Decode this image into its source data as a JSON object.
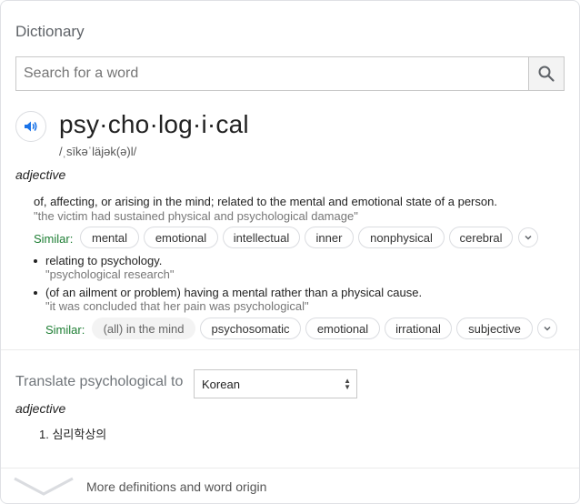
{
  "header": {
    "title": "Dictionary"
  },
  "search": {
    "placeholder": "Search for a word",
    "icon": "search-icon"
  },
  "entry": {
    "headword": "psy·cho·log·i·cal",
    "phonetic": "/ˌsīkəˈläjək(ə)l/",
    "part_of_speech": "adjective",
    "definitions": [
      {
        "text": "of, affecting, or arising in the mind; related to the mental and emotional state of a person.",
        "example": "\"the victim had sustained physical and psychological damage\"",
        "similar_label": "Similar:",
        "similar": [
          "mental",
          "emotional",
          "intellectual",
          "inner",
          "nonphysical",
          "cerebral"
        ]
      }
    ],
    "sub_definitions": [
      {
        "text": "relating to psychology.",
        "example": "\"psychological research\""
      },
      {
        "text": "(of an ailment or problem) having a mental rather than a physical cause.",
        "example": "\"it was concluded that her pain was psychological\""
      }
    ],
    "similar2_label": "Similar:",
    "similar2": [
      "(all) in the mind",
      "psychosomatic",
      "emotional",
      "irrational",
      "subjective"
    ]
  },
  "translate": {
    "label": "Translate psychological to",
    "language": "Korean",
    "part_of_speech": "adjective",
    "items": [
      "1. 심리학상의"
    ]
  },
  "footer": {
    "more_label": "More definitions and word origin"
  }
}
